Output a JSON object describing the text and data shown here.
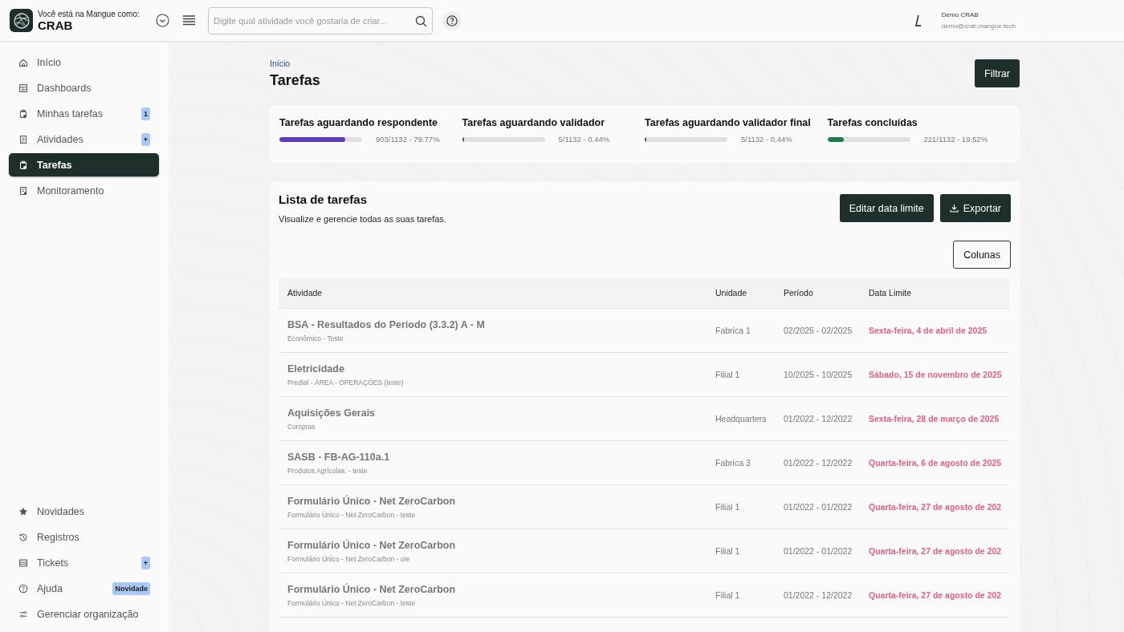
{
  "header": {
    "org_caption": "Você está na Mangue como:",
    "org_name": "CRAB",
    "search": {
      "placeholder": "Digite qual atividade você gostaria de criar..."
    },
    "user": {
      "name": "Demo CRAB",
      "email": "demo@crab.mangue.tech"
    }
  },
  "sidebar": {
    "items": [
      {
        "label": "Início",
        "selected": false
      },
      {
        "label": "Dashboards",
        "selected": false
      },
      {
        "label": "Minhas tarefas",
        "selected": false,
        "badge": "1"
      },
      {
        "label": "Atividades",
        "selected": false,
        "badge": "+"
      },
      {
        "label": "Tarefas",
        "selected": true
      },
      {
        "label": "Monitoramento",
        "selected": false
      }
    ],
    "bottom_items": [
      {
        "label": "Novidades",
        "selected": false
      },
      {
        "label": "Registros",
        "selected": false
      },
      {
        "label": "Tickets",
        "selected": false,
        "badge": "+"
      },
      {
        "label": "Ajuda",
        "selected": false,
        "badge": "Novidade"
      },
      {
        "label": "Gerenciar organização",
        "selected": false
      }
    ]
  },
  "breadcrumb": "Início",
  "page_title": "Tarefas",
  "filter_button": "Filtrar",
  "stats": [
    {
      "title": "Tarefas aguardando respondente",
      "level": 0.7977,
      "reading": "903/1132 - 79.77%",
      "color": "#5b3cc4"
    },
    {
      "title": "Tarefas aguardando validador",
      "level": 0.0044,
      "reading": "5/1132 - 0.44%",
      "color": "#555555"
    },
    {
      "title": "Tarefas aguardando validador final",
      "level": 0.0044,
      "reading": "5/1132 - 0.44%",
      "color": "#555555"
    },
    {
      "title": "Tarefas concluídas",
      "level": 0.1952,
      "reading": "221/1132 - 19.52%",
      "color": "#15804b"
    }
  ],
  "task_list": {
    "title": "Lista de tarefas",
    "subtitle": "Visualize e gerencie todas as suas tarefas.",
    "edit_button": "Editar data limite",
    "export_button": "Exportar",
    "columns_button": "Colunas",
    "columns": [
      "Atividade",
      "Unidade",
      "Período",
      "Data Limite"
    ],
    "rows": [
      {
        "activity": "BSA - Resultados do Período (3.3.2) A - M",
        "detail": "Econômico - Teste",
        "unit": "Fabrica 1",
        "period": "02/2025 - 02/2025",
        "deadline": "Sexta-feira, 4 de abril de 2025"
      },
      {
        "activity": "Eletricidade",
        "detail": "Predial - ÁREA - OPERAÇÕES (teste)",
        "unit": "Filial 1",
        "period": "10/2025 - 10/2025",
        "deadline": "Sábado, 15 de novembro de 2025"
      },
      {
        "activity": "Aquisições Gerais",
        "detail": "Compras",
        "unit": "Headquarters",
        "period": "01/2022 - 12/2022",
        "deadline": "Sexta-feira, 28 de março de 2025"
      },
      {
        "activity": "SASB - FB-AG-110a.1",
        "detail": "Produtos Agrícolas. - teste",
        "unit": "Fabrica 3",
        "period": "01/2022 - 12/2022",
        "deadline": "Quarta-feira, 6 de agosto de 2025"
      },
      {
        "activity": "Formulário Único - Net ZeroCarbon",
        "detail": "Formulário Único - Net ZeroCarbon - teste",
        "unit": "Filial 1",
        "period": "01/2022 - 01/2022",
        "deadline": "Quarta-feira, 27 de agosto de 202"
      },
      {
        "activity": "Formulário Único - Net ZeroCarbon",
        "detail": "Formulário Único - Net ZeroCarbon - oie",
        "unit": "Filial 1",
        "period": "01/2022 - 01/2022",
        "deadline": "Quarta-feira, 27 de agosto de 202"
      },
      {
        "activity": "Formulário Único - Net ZeroCarbon",
        "detail": "Formulário Único - Net ZeroCarbon - teste",
        "unit": "Filial 1",
        "period": "01/2022 - 12/2022",
        "deadline": "Quarta-feira, 27 de agosto de 202"
      }
    ]
  }
}
